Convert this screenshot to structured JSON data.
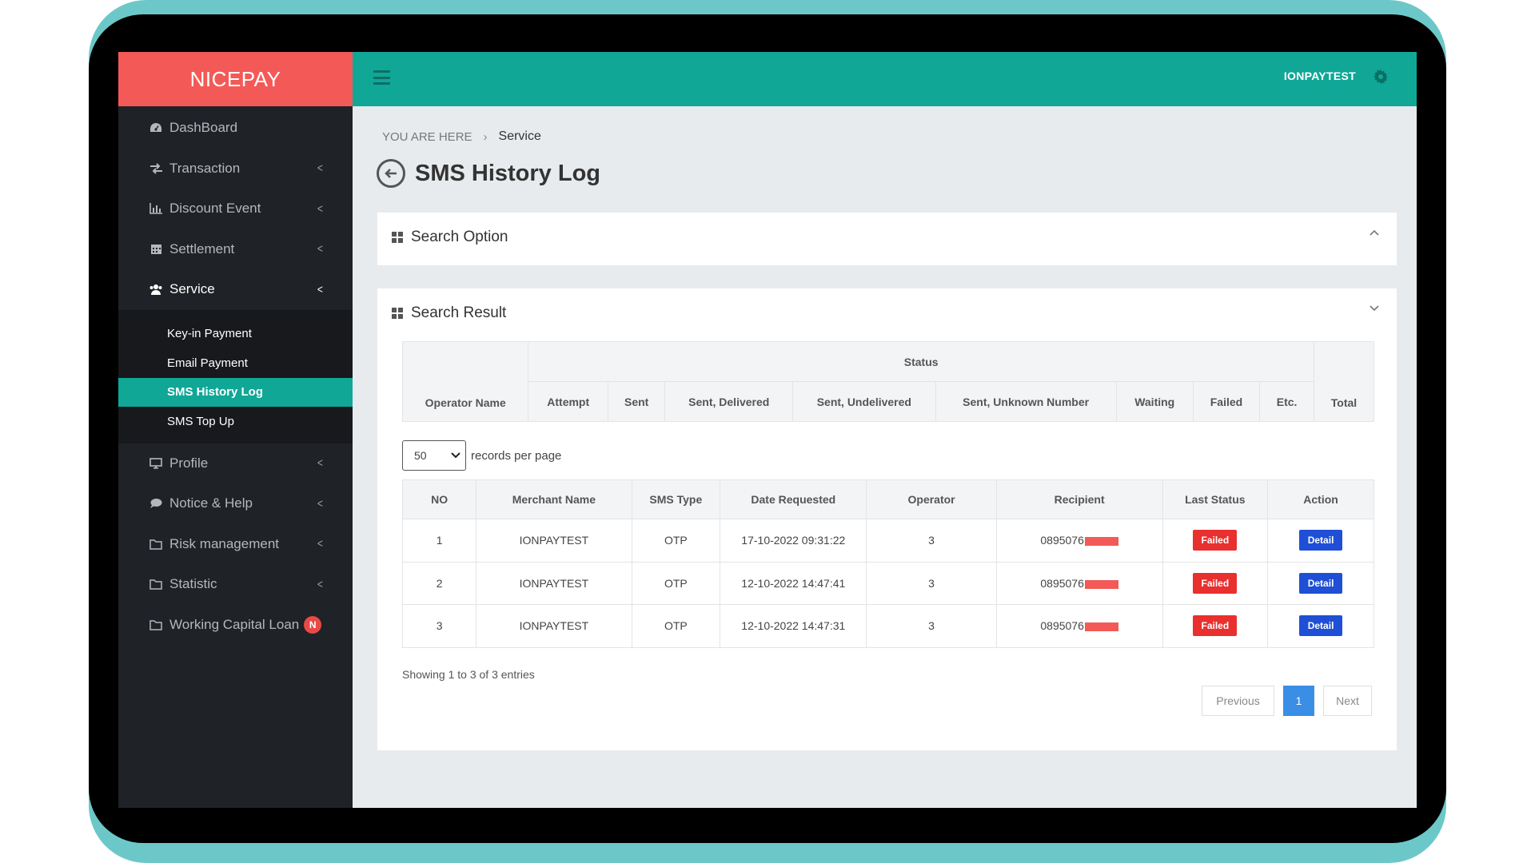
{
  "brand": {
    "name": "NICEPAY"
  },
  "colors": {
    "brand": "#f35a57",
    "topbar": "#10a797",
    "sidebar": "#1f2226",
    "failed": "#e8302f",
    "detail": "#1f4fd6",
    "page_active": "#3a8ee6"
  },
  "topbar": {
    "user": "IONPAYTEST",
    "menu_icon": "hamburger-icon",
    "settings_icon": "gear-icon"
  },
  "sidebar": {
    "items": [
      {
        "label": "DashBoard",
        "icon": "dashboard-icon"
      },
      {
        "label": "Transaction",
        "icon": "exchange-icon"
      },
      {
        "label": "Discount Event",
        "icon": "bar-chart-icon"
      },
      {
        "label": "Settlement",
        "icon": "calendar-icon"
      },
      {
        "label": "Service",
        "icon": "users-icon"
      }
    ],
    "service_submenu": [
      {
        "label": "Key-in Payment"
      },
      {
        "label": "Email Payment"
      },
      {
        "label": "SMS History Log"
      },
      {
        "label": "SMS Top Up"
      }
    ],
    "items_after": [
      {
        "label": "Profile",
        "icon": "monitor-icon"
      },
      {
        "label": "Notice & Help",
        "icon": "comment-icon"
      },
      {
        "label": "Risk management",
        "icon": "folder-icon"
      },
      {
        "label": "Statistic",
        "icon": "folder-icon"
      },
      {
        "label": "Working Capital Loan",
        "icon": "folder-icon",
        "badge": "N"
      }
    ]
  },
  "breadcrumb": {
    "prefix": "YOU ARE HERE",
    "separator": "›",
    "current": "Service"
  },
  "page": {
    "title": "SMS History Log"
  },
  "search_option": {
    "title": "Search Option"
  },
  "search_result": {
    "title": "Search Result",
    "summary": {
      "operator_header": "Operator Name",
      "group_header": "Status",
      "status_headers": [
        "Attempt",
        "Sent",
        "Sent, Delivered",
        "Sent, Undelivered",
        "Sent, Unknown Number",
        "Waiting",
        "Failed",
        "Etc."
      ],
      "total_header": "Total"
    },
    "records": {
      "value": "50",
      "label": "records per page"
    },
    "columns": [
      "NO",
      "Merchant Name",
      "SMS Type",
      "Date Requested",
      "Operator",
      "Recipient",
      "Last Status",
      "Action"
    ],
    "rows": [
      {
        "no": "1",
        "merchant": "IONPAYTEST",
        "type": "OTP",
        "date": "17-10-2022 09:31:22",
        "operator": "3",
        "recipient": "0895076",
        "status": "Failed",
        "action": "Detail"
      },
      {
        "no": "2",
        "merchant": "IONPAYTEST",
        "type": "OTP",
        "date": "12-10-2022 14:47:41",
        "operator": "3",
        "recipient": "0895076",
        "status": "Failed",
        "action": "Detail"
      },
      {
        "no": "3",
        "merchant": "IONPAYTEST",
        "type": "OTP",
        "date": "12-10-2022 14:47:31",
        "operator": "3",
        "recipient": "0895076",
        "status": "Failed",
        "action": "Detail"
      }
    ],
    "showing": "Showing 1 to 3 of 3 entries",
    "pagination": {
      "previous": "Previous",
      "current": "1",
      "next": "Next"
    }
  }
}
